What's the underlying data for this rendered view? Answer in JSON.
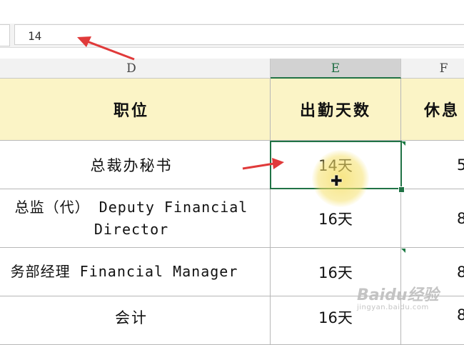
{
  "formula_bar": {
    "value": "14"
  },
  "columns": [
    {
      "id": "d",
      "label": "D"
    },
    {
      "id": "e",
      "label": "E",
      "selected": true
    },
    {
      "id": "f",
      "label": "F"
    }
  ],
  "header_row": {
    "d": "职位",
    "e": "出勤天数",
    "f": "休息"
  },
  "rows": [
    {
      "d": "总裁办秘书",
      "e": "14天",
      "f": "5"
    },
    {
      "d": "总监（代） Deputy Financial Director",
      "e": "16天",
      "f": "8"
    },
    {
      "d": "务部经理 Financial Manager",
      "e": "16天",
      "f": "8"
    },
    {
      "d": "会计",
      "e": "16天",
      "f": "8"
    }
  ],
  "watermark": {
    "line1": "Baidu经验",
    "line2": "jingyan.baidu.com"
  },
  "colors": {
    "selection": "#217346",
    "header_fill": "#fbf4c6",
    "annotation_arrow": "#e03a3a"
  }
}
